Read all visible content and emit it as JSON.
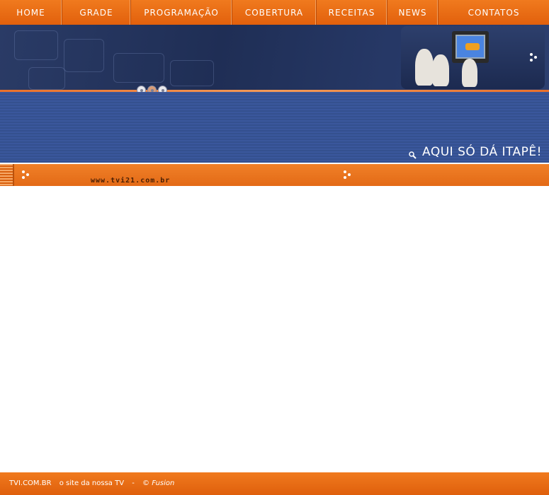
{
  "nav": {
    "items": [
      {
        "label": "HOME",
        "name": "nav-home"
      },
      {
        "label": "GRADE",
        "name": "nav-grade"
      },
      {
        "label": "PROGRAMAÇÃO",
        "name": "nav-programacao"
      },
      {
        "label": "COBERTURA",
        "name": "nav-cobertura"
      },
      {
        "label": "RECEITAS",
        "name": "nav-receitas"
      },
      {
        "label": "NEWS",
        "name": "nav-news"
      },
      {
        "label": "CONTATOS",
        "name": "nav-contatos"
      }
    ]
  },
  "banner": {
    "slogan": "AQUI SÓ DÁ ITAPÊ!",
    "slogan_icon": "magnifier-icon",
    "reels_icon": "film-reel-icon",
    "photo_icon": "children-watching-tv-photo"
  },
  "subbar": {
    "url": "www.tvi21.com.br"
  },
  "footer": {
    "site": "TVI.COM.BR",
    "tagline": "o site da nossa TV",
    "separator": "-",
    "credit": "© Fusion"
  },
  "colors": {
    "orange": "#e96c17",
    "navy": "#23345e",
    "blue_stripe": "#3a579c",
    "white": "#ffffff"
  }
}
